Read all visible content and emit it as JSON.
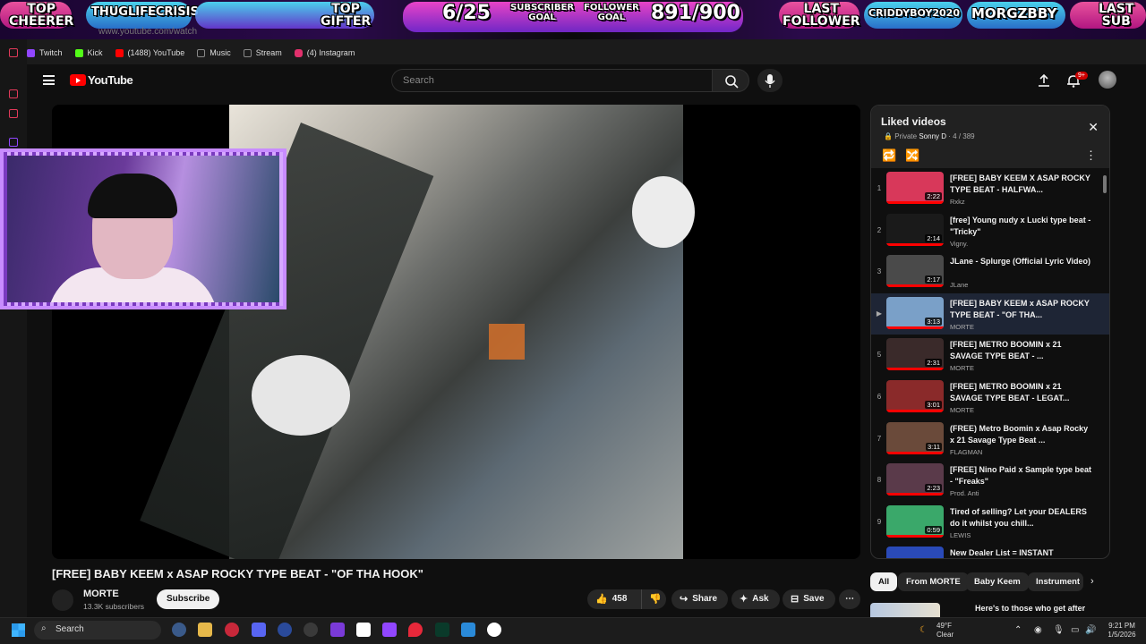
{
  "overlay": {
    "top_cheerer_label": "TOP\nCHEERER",
    "top_cheerer_name": "THUGLIFECRISIS",
    "top_gifter_label": "TOP\nGIFTER",
    "subscriber_goal_value": "6/25",
    "subscriber_goal_label": "SUBSCRIBER\nGOAL",
    "follower_goal_label": "FOLLOWER\nGOAL",
    "follower_goal_value": "891/900",
    "last_follower_label": "LAST\nFOLLOWER",
    "last_follower_name": "CRIDDYBOY2020",
    "last_sub_name": "MORGZBBY",
    "last_sub_label": "LAST\nSUB"
  },
  "browser": {
    "url": "www.youtube.com/watch",
    "bookmarks": [
      {
        "label": "Twitch",
        "color": "#9146ff"
      },
      {
        "label": "Kick",
        "color": "#53fc18"
      },
      {
        "label": "(1488) YouTube",
        "color": "#ff0000"
      },
      {
        "label": "Music",
        "color": "#888888"
      },
      {
        "label": "Stream",
        "color": "#888888"
      },
      {
        "label": "(4) Instagram",
        "color": "#e1306c"
      }
    ]
  },
  "header": {
    "logo_text": "YouTube",
    "search_placeholder": "Search",
    "notifications_badge": "9+"
  },
  "video": {
    "title": "[FREE] BABY KEEM x ASAP ROCKY TYPE BEAT - \"OF THA HOOK\"",
    "channel": "MORTE",
    "subscribers": "13.3K subscribers",
    "subscribe_label": "Subscribe",
    "likes": "458",
    "share_label": "Share",
    "ask_label": "Ask",
    "save_label": "Save"
  },
  "playlist": {
    "title": "Liked videos",
    "privacy": "Private",
    "owner": "Sonny D",
    "position": "4 / 389",
    "items": [
      {
        "index": "1",
        "title": "[FREE] BABY KEEM X ASAP ROCKY TYPE BEAT - HALFWA...",
        "channel": "Rxkz",
        "duration": "2:22",
        "color": "#d8385a",
        "active": false
      },
      {
        "index": "2",
        "title": "[free] Young nudy x Lucki type beat - \"Tricky\"",
        "channel": "Vigny.",
        "duration": "2:14",
        "color": "#1a1a1a",
        "active": false
      },
      {
        "index": "3",
        "title": "JLane - Splurge (Official Lyric Video)",
        "channel": "JLane",
        "duration": "2:17",
        "color": "#4a4a4a",
        "active": false
      },
      {
        "index": "▶",
        "title": "[FREE] BABY KEEM x ASAP ROCKY TYPE BEAT - \"OF THA...",
        "channel": "MORTE",
        "duration": "3:13",
        "color": "#7aa0c8",
        "active": true
      },
      {
        "index": "5",
        "title": "[FREE] METRO BOOMIN x 21 SAVAGE TYPE BEAT - ...",
        "channel": "MORTE",
        "duration": "2:31",
        "color": "#3a2a2a",
        "active": false
      },
      {
        "index": "6",
        "title": "[FREE] METRO BOOMIN x 21 SAVAGE TYPE BEAT - LEGAT...",
        "channel": "MORTE",
        "duration": "3:01",
        "color": "#8a2a2a",
        "active": false
      },
      {
        "index": "7",
        "title": "(FREE) Metro Boomin x Asap Rocky x 21 Savage Type Beat ...",
        "channel": "FLAGMAN",
        "duration": "3:11",
        "color": "#6a4a3a",
        "active": false
      },
      {
        "index": "8",
        "title": "[FREE] Nino Paid x Sample type beat - \"Freaks\"",
        "channel": "Prod. Anti",
        "duration": "2:23",
        "color": "#5a3a4a",
        "active": false
      },
      {
        "index": "9",
        "title": "Tired of selling? Let your DEALERS do it whilst you chill...",
        "channel": "LEWIS",
        "duration": "0:59",
        "color": "#3aa86a",
        "active": false
      },
      {
        "index": "",
        "title": "New Dealer List = INSTANT",
        "channel": "",
        "duration": "",
        "color": "#2a4ab8",
        "active": false
      }
    ]
  },
  "chips": [
    "All",
    "From MORTE",
    "Baby Keem",
    "Instrument"
  ],
  "recommended": {
    "title": "Here's to those who get after"
  },
  "taskbar": {
    "search_label": "Search",
    "weather_temp": "49°F",
    "weather_desc": "Clear",
    "time": "9:21 PM",
    "date": "1/5/2026"
  }
}
